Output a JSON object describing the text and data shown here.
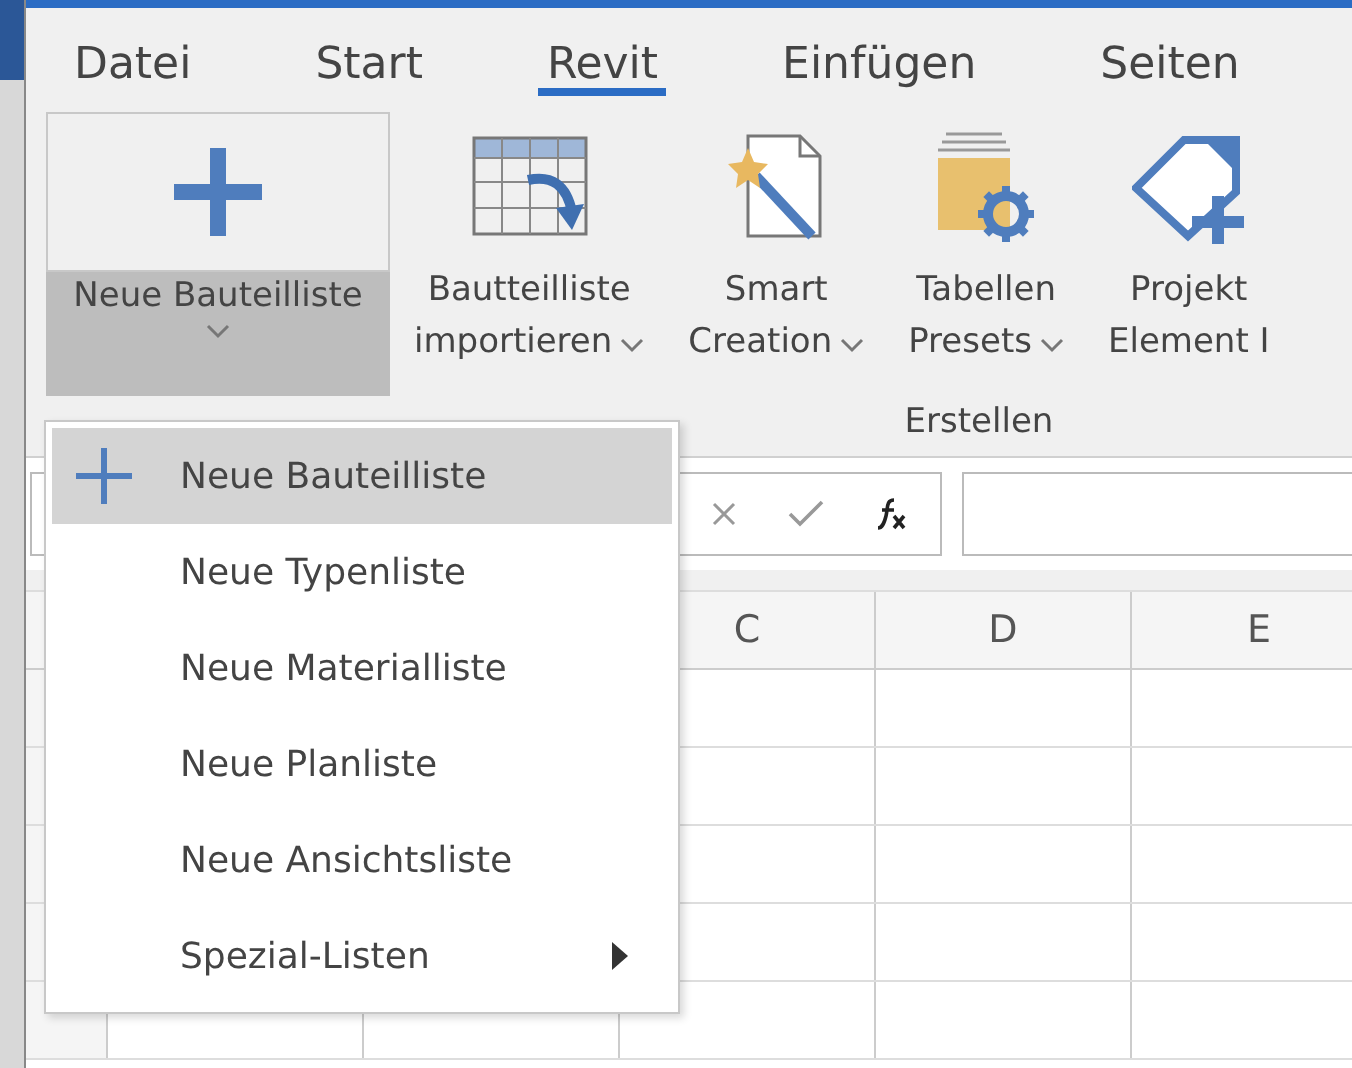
{
  "tabs": [
    {
      "label": "Datei",
      "selected": false
    },
    {
      "label": "Start",
      "selected": false
    },
    {
      "label": "Revit",
      "selected": true
    },
    {
      "label": "Einfügen",
      "selected": false
    },
    {
      "label": "Seiten",
      "selected": false
    }
  ],
  "ribbon": {
    "buttons": [
      {
        "kind": "new-list",
        "lines": [
          "Neue Bauteilliste"
        ],
        "dropdown": true,
        "pressed": true
      },
      {
        "kind": "import",
        "lines": [
          "Bautteilliste",
          "importieren"
        ],
        "dropdown": true,
        "pressed": false
      },
      {
        "kind": "smart",
        "lines": [
          "Smart",
          "Creation"
        ],
        "dropdown": true,
        "pressed": false
      },
      {
        "kind": "presets",
        "lines": [
          "Tabellen",
          "Presets"
        ],
        "dropdown": true,
        "pressed": false
      },
      {
        "kind": "tag",
        "lines": [
          "Projekt",
          "Element I"
        ],
        "dropdown": false,
        "pressed": false
      }
    ],
    "group_label": "Erstellen"
  },
  "grid": {
    "columns": [
      "C",
      "D",
      "E"
    ]
  },
  "menu": {
    "items": [
      {
        "label": "Neue Bauteilliste",
        "selected": true,
        "kind": "plus"
      },
      {
        "label": "Neue Typenliste",
        "selected": false,
        "kind": "plain"
      },
      {
        "label": "Neue Materialliste",
        "selected": false,
        "kind": "plain"
      },
      {
        "label": "Neue Planliste",
        "selected": false,
        "kind": "plain"
      },
      {
        "label": "Neue Ansichtsliste",
        "selected": false,
        "kind": "plain"
      },
      {
        "label": "Spezial-Listen",
        "selected": false,
        "kind": "submenu"
      }
    ]
  }
}
